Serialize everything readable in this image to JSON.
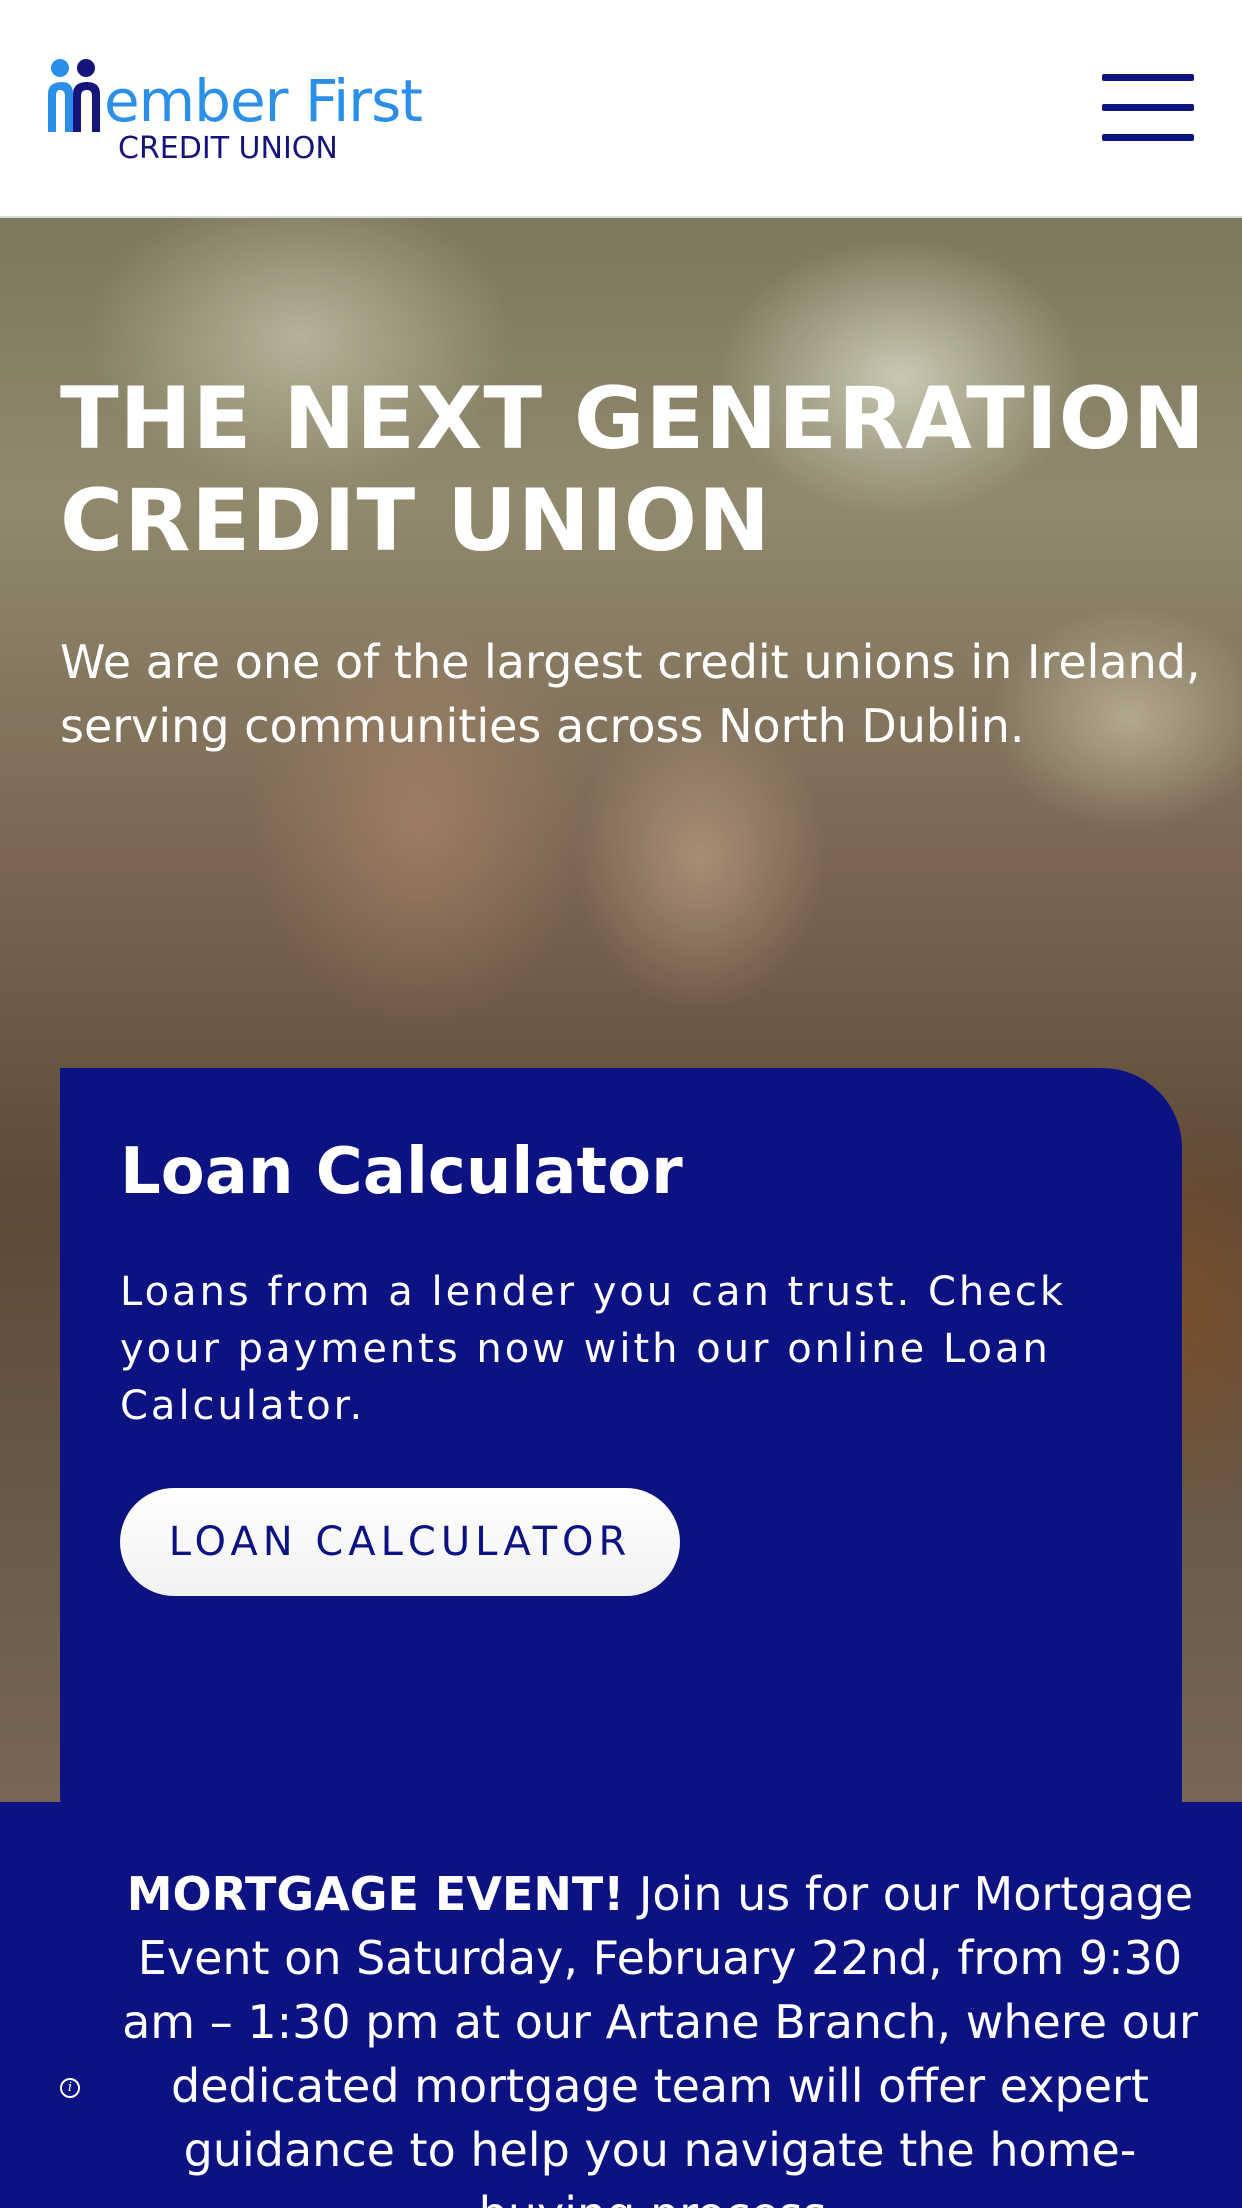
{
  "header": {
    "logo_text": "member First",
    "logo_subtitle": "CREDIT UNION",
    "menu_icon": "hamburger-menu-icon",
    "colors": {
      "logo_blue": "#2b8ee8",
      "navy": "#0d1480"
    }
  },
  "hero": {
    "title_line1": "THE NEXT GENERATION",
    "title_line2": "CREDIT UNION",
    "subtitle_line1": "We are one of the largest credit unions in Ireland,",
    "subtitle_line2": "serving communities across North Dublin."
  },
  "loan_card": {
    "title": "Loan Calculator",
    "desc_line1": "Loans from a lender you can trust. Check",
    "desc_line2": "your payments now with our online Loan",
    "desc_line3": "Calculator.",
    "button_label": "LOAN CALCULATOR",
    "background": "#0c1282"
  },
  "banner": {
    "strong_text": "MORTGAGE EVENT!",
    "line1_rest": " Join us for our Mortgage",
    "line2": "Event on Saturday, February 22nd, from 9:30",
    "line3": "am – 1:30 pm at our Artane Branch, where our",
    "line4": "dedicated mortgage team will offer expert",
    "line5": "guidance to help you navigate the home-",
    "line6": "buying process.",
    "info_icon": "info-icon"
  }
}
